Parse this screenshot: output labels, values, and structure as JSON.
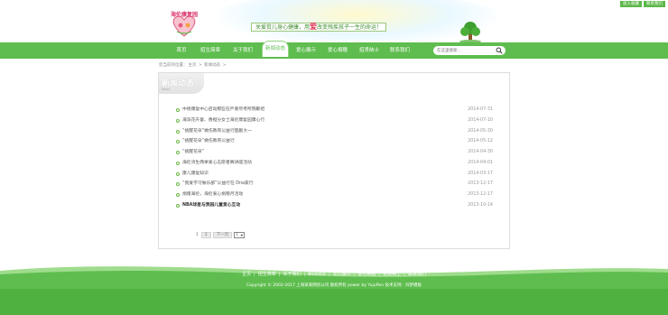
{
  "header": {
    "logo_text": "海伦康复园",
    "slogan_parts": [
      "关爱贫儿身心健康，用",
      "爱",
      "改变残疾孩子一生的命运！"
    ],
    "top_links": [
      "加入收藏",
      "联系我们"
    ]
  },
  "nav": {
    "items": [
      "首页",
      "招生简章",
      "关于我们",
      "新闻动态",
      "爱心展示",
      "爱心捐赠",
      "招贤纳士",
      "联系我们"
    ],
    "active_index": 3,
    "search_placeholder": "在这里搜索..."
  },
  "breadcrumb": [
    "您当前的位置：",
    "主页",
    ">",
    "新闻动态",
    ">"
  ],
  "panel": {
    "title": "新闻动态",
    "subtitle": "News"
  },
  "news": [
    {
      "title": "中德康复中心启动那些在严重尽考所院聚招",
      "date": "2014-07-31",
      "bold": false
    },
    {
      "title": "海滨花卉童、香橙分女士海伦康复园康心行",
      "date": "2014-07-10",
      "bold": false
    },
    {
      "title": "“挑醒花朵”做伤教育公益行图剧大一",
      "date": "2014-05-30",
      "bold": false
    },
    {
      "title": "“挑醒花朵”做伤教育公益行",
      "date": "2014-05-12",
      "bold": false
    },
    {
      "title": "“挑醒花朵”",
      "date": "2014-04-30",
      "bold": false
    },
    {
      "title": "海伦湾生两举爱心志愿者赛讲座活动",
      "date": "2014-04-01",
      "bold": false
    },
    {
      "title": "康儿康复知识",
      "date": "2014-03-17",
      "bold": false
    },
    {
      "title": "“我爱学习做乐部”公益行在 Dna家行",
      "date": "2013-12-17",
      "bold": false
    },
    {
      "title": "捐赠海伦，海伦爱心捐赠月活动",
      "date": "2013-12-17",
      "bold": false
    },
    {
      "title": "NBA球星与我园儿童爱心互动",
      "date": "2013-10-14",
      "bold": true
    }
  ],
  "pagination": {
    "current": "1",
    "other": "2",
    "next_label": "下一页",
    "select_value": "1"
  },
  "footer": {
    "links": [
      "主页",
      "招生简章",
      "关于我们",
      "新闻动态",
      "爱心展示",
      "爱心捐赠",
      "招贤纳士",
      "联系我们"
    ],
    "copyright": "Copyright © 2002-2017 上海某某网创公司 版权所有 power by YujuRen   技术支持：归梦模板"
  },
  "colors": {
    "brand_green": "#5ebd4e",
    "heart_red": "#e0304e"
  }
}
